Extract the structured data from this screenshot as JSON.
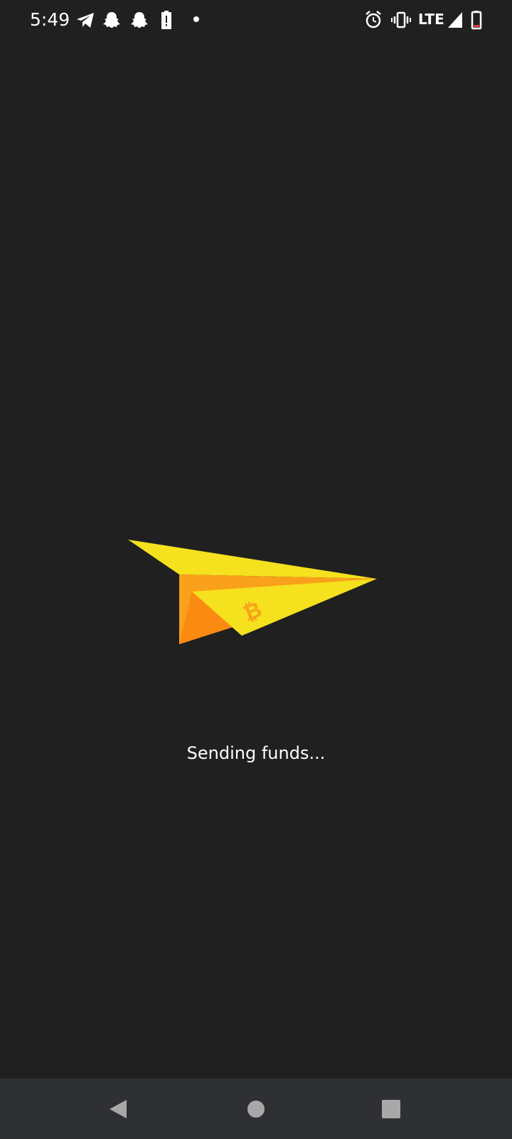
{
  "status_bar": {
    "time": "5:49",
    "network": "LTE",
    "icons": [
      "telegram-icon",
      "snapchat-icon",
      "snapchat-icon",
      "battery-alert-icon",
      "notification-dot-icon",
      "alarm-icon",
      "vibrate-icon",
      "signal-icon",
      "battery-icon"
    ]
  },
  "main": {
    "status_text": "Sending funds...",
    "illustration": "paper-plane-bitcoin-icon"
  },
  "nav_bar": {
    "buttons": [
      "back",
      "home",
      "recents"
    ]
  },
  "colors": {
    "background": "#202020",
    "nav_background": "#2f3034",
    "plane_yellow": "#f5e11d",
    "plane_orange": "#f9a11b",
    "plane_dark_orange": "#fb8a13"
  }
}
